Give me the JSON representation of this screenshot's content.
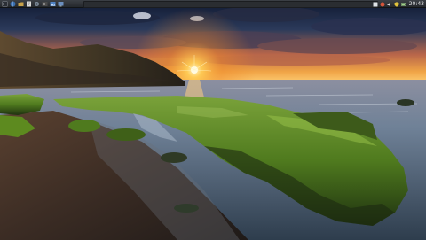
{
  "panel": {
    "launchers": [
      {
        "name": "terminal-icon",
        "color": "#2b2f36"
      },
      {
        "name": "web-browser-icon",
        "color": "#3a6fb0"
      },
      {
        "name": "file-manager-icon",
        "color": "#c8a24a"
      },
      {
        "name": "text-editor-icon",
        "color": "#d9d9d9"
      },
      {
        "name": "settings-icon",
        "color": "#7c8a99"
      },
      {
        "name": "media-player-icon",
        "color": "#4a4a4a"
      },
      {
        "name": "image-viewer-icon",
        "color": "#4f82c4"
      },
      {
        "name": "show-desktop-icon",
        "color": "#6b8fbf"
      }
    ],
    "tray": [
      {
        "name": "notes-icon",
        "color": "#dfe3e6"
      },
      {
        "name": "network-icon",
        "color": "#d5553a"
      },
      {
        "name": "volume-icon",
        "color": "#cfd3d6"
      },
      {
        "name": "security-shield-icon",
        "color": "#e0c23b"
      },
      {
        "name": "battery-icon",
        "color": "#9fd08a"
      }
    ],
    "clock": "20:43"
  },
  "wallpaper": {
    "description_colors": {
      "sky_top": "#0f1830",
      "sunset": "#ffb233",
      "sea": "#8fa6bd",
      "moss": "#5d8a1f"
    }
  }
}
